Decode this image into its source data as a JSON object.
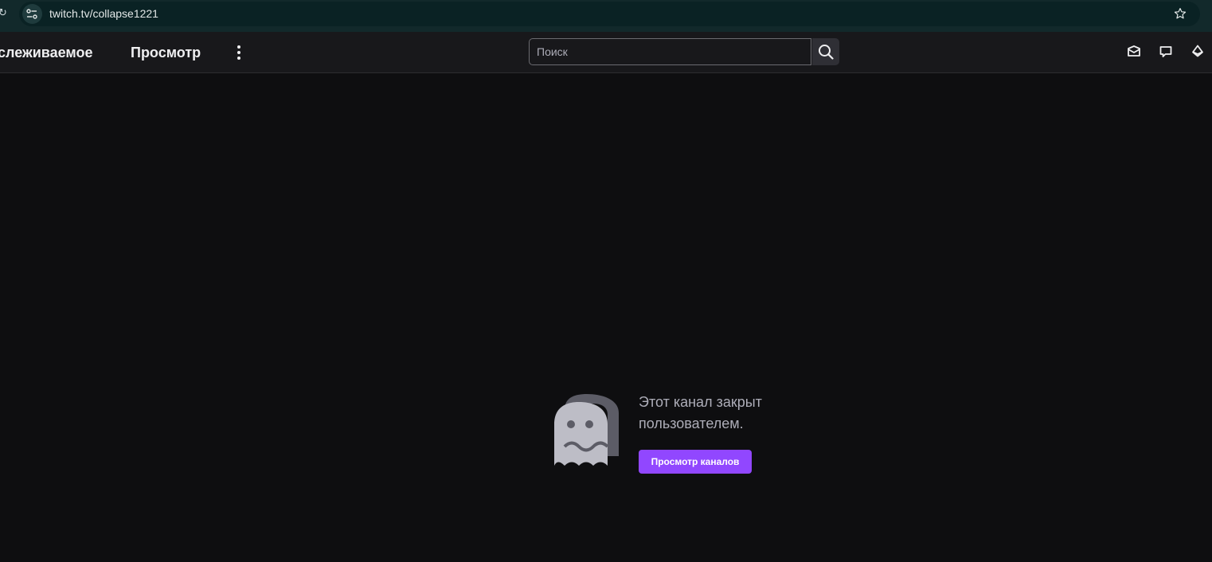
{
  "browser": {
    "url": "twitch.tv/collapse1221"
  },
  "nav": {
    "following_label": "слеживаемое",
    "browse_label": "Просмотр",
    "search_placeholder": "Поиск"
  },
  "icons": [
    "reload-icon",
    "site-info-icon",
    "bookmark-star-icon",
    "more-vertical-icon",
    "search-icon",
    "inbox-icon",
    "whispers-icon",
    "bits-icon",
    "ghost-icon"
  ],
  "channel": {
    "closed_message": "Этот канал закрыт пользователем.",
    "browse_button_label": "Просмотр каналов"
  },
  "colors": {
    "accent": "#9147ff",
    "background": "#0e0e10",
    "nav_background": "#18181b"
  }
}
